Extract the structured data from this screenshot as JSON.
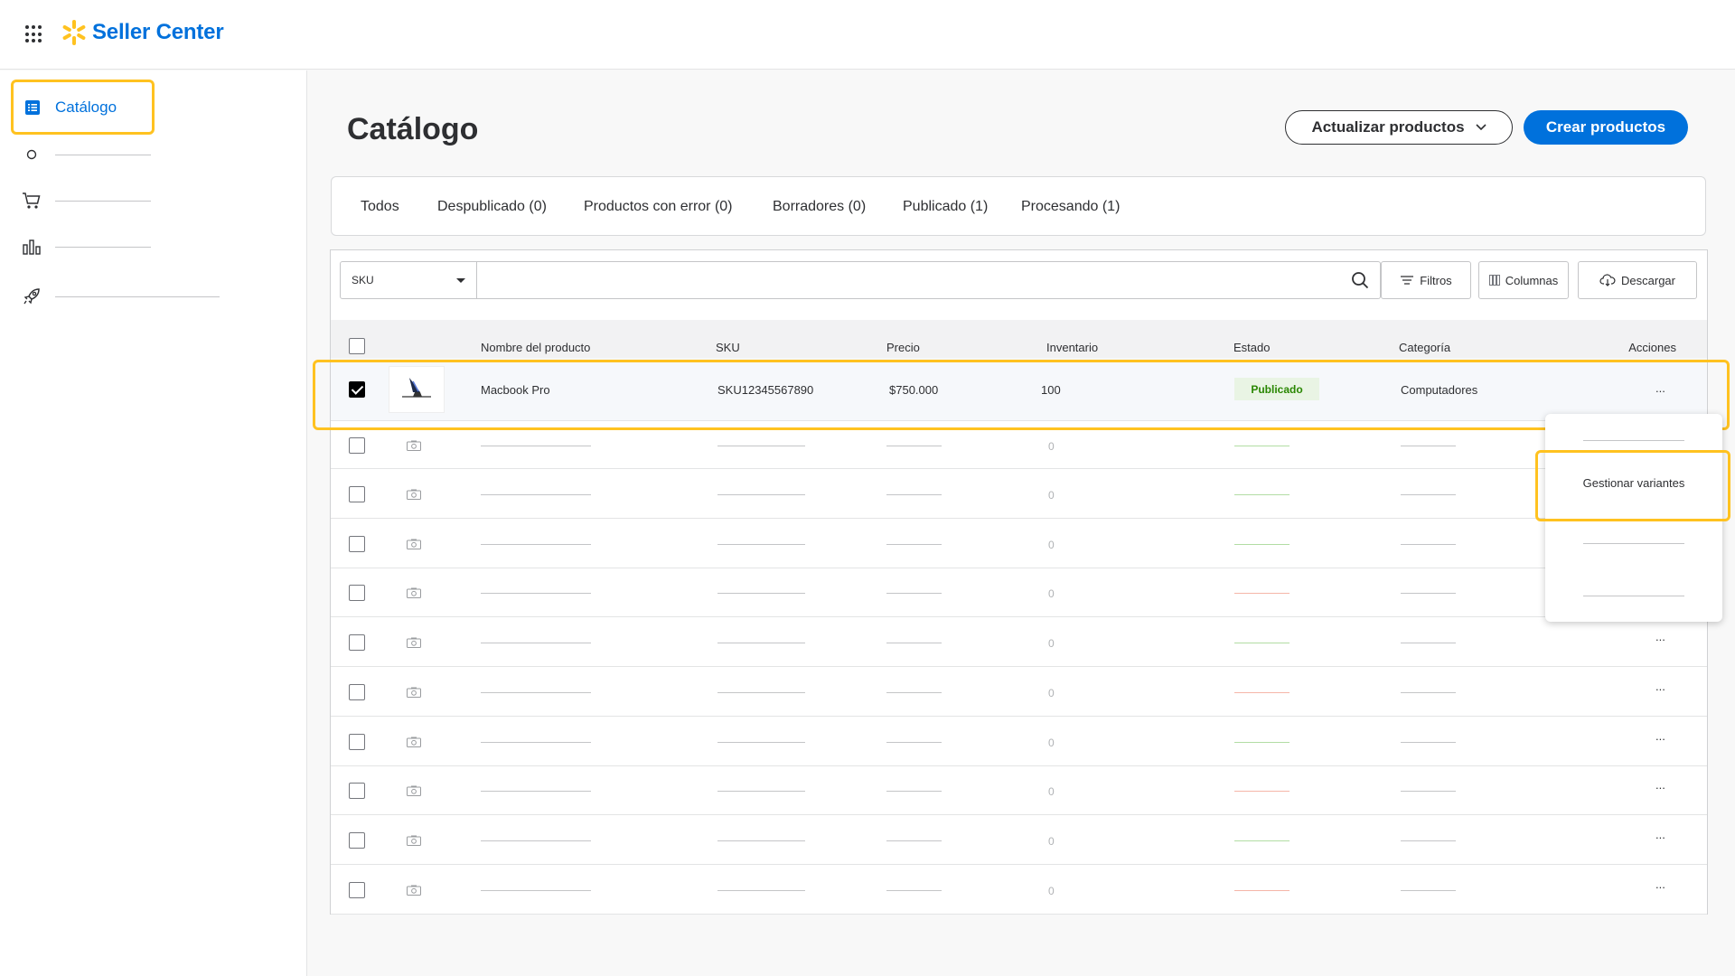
{
  "brand": {
    "name": "Seller Center",
    "color": "#0071dc",
    "spark_color": "#ffc220"
  },
  "sidebar": {
    "active_item": {
      "label": "Catálogo",
      "icon": "list-icon"
    },
    "items": [
      {
        "icon": "circle-icon"
      },
      {
        "icon": "cart-icon"
      },
      {
        "icon": "bar-chart-icon"
      },
      {
        "icon": "rocket-icon"
      }
    ]
  },
  "header": {
    "title": "Catálogo",
    "update_label": "Actualizar productos",
    "create_label": "Crear productos"
  },
  "tabs": [
    {
      "label": "Todos"
    },
    {
      "label": "Despublicado (0)"
    },
    {
      "label": "Productos con error (0)"
    },
    {
      "label": "Borradores (0)"
    },
    {
      "label": "Publicado (1)"
    },
    {
      "label": "Procesando (1)"
    }
  ],
  "toolbar": {
    "search_field": "SKU",
    "search_value": "",
    "filters_label": "Filtros",
    "columns_label": "Columnas",
    "download_label": "Descargar"
  },
  "table": {
    "columns": {
      "name": "Nombre del producto",
      "sku": "SKU",
      "price": "Precio",
      "inventory": "Inventario",
      "status": "Estado",
      "category": "Categoría",
      "actions": "Acciones"
    },
    "first_row": {
      "checked": true,
      "name": "Macbook Pro",
      "sku": "SKU12345567890",
      "price": "$750.000",
      "inventory": "100",
      "status": "Publicado",
      "category": "Computadores",
      "actions": "..."
    },
    "placeholder_rows": [
      {
        "inventory": "0",
        "status_color": "#54b435",
        "actions": ""
      },
      {
        "inventory": "0",
        "status_color": "#54b435",
        "actions": ""
      },
      {
        "inventory": "0",
        "status_color": "#54b435",
        "actions": ""
      },
      {
        "inventory": "0",
        "status_color": "#e85d3f",
        "actions": ""
      },
      {
        "inventory": "0",
        "status_color": "#54b435",
        "actions": "..."
      },
      {
        "inventory": "0",
        "status_color": "#e85d3f",
        "actions": "..."
      },
      {
        "inventory": "0",
        "status_color": "#54b435",
        "actions": "..."
      },
      {
        "inventory": "0",
        "status_color": "#e85d3f",
        "actions": "..."
      },
      {
        "inventory": "0",
        "status_color": "#54b435",
        "actions": "..."
      },
      {
        "inventory": "0",
        "status_color": "#e85d3f",
        "actions": "..."
      }
    ]
  },
  "actions_menu": {
    "items": [
      {
        "label": ""
      },
      {
        "label": "Gestionar variantes"
      },
      {
        "label": ""
      },
      {
        "label": ""
      }
    ]
  },
  "highlight_color": "#ffc220"
}
